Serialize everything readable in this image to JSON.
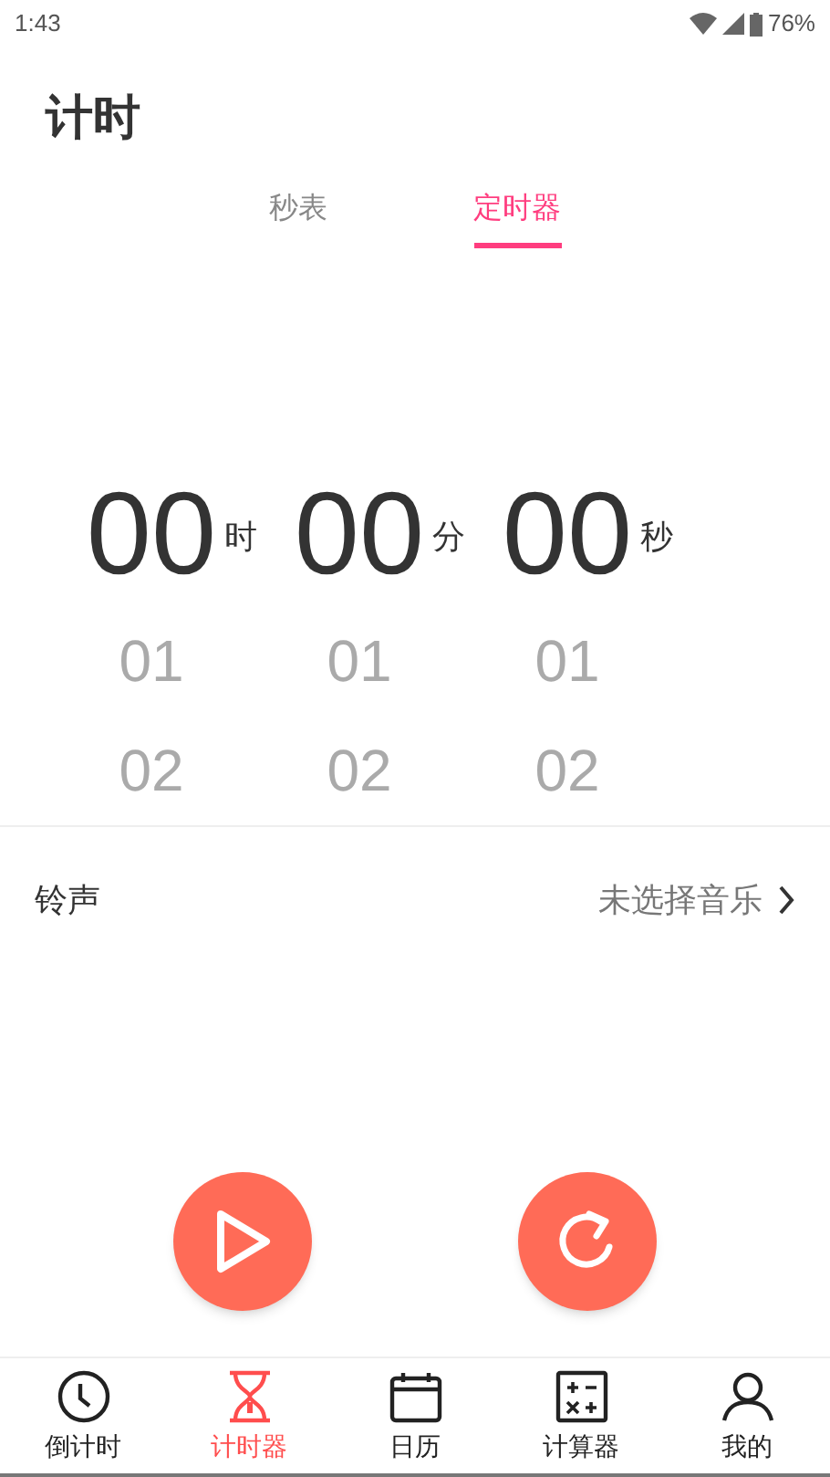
{
  "status_bar": {
    "time": "1:43",
    "battery": "76%"
  },
  "title": "计时",
  "tabs": [
    {
      "label": "秒表",
      "selected": false
    },
    {
      "label": "定时器",
      "selected": true
    }
  ],
  "picker": [
    {
      "unit": "时",
      "values": [
        {
          "text": "00",
          "selected": true
        },
        {
          "text": "01",
          "selected": false
        },
        {
          "text": "02",
          "selected": false
        }
      ]
    },
    {
      "unit": "分",
      "values": [
        {
          "text": "00",
          "selected": true
        },
        {
          "text": "01",
          "selected": false
        },
        {
          "text": "02",
          "selected": false
        }
      ]
    },
    {
      "unit": "秒",
      "values": [
        {
          "text": "00",
          "selected": true
        },
        {
          "text": "01",
          "selected": false
        },
        {
          "text": "02",
          "selected": false
        }
      ]
    }
  ],
  "ringtone": {
    "label": "铃声",
    "value": "未选择音乐"
  },
  "actions": [
    {
      "kind": "play"
    },
    {
      "kind": "reset"
    }
  ],
  "nav": [
    {
      "kind": "clock",
      "label": "倒计时",
      "selected": false
    },
    {
      "kind": "hourglass",
      "label": "计时器",
      "selected": true
    },
    {
      "kind": "calendar",
      "label": "日历",
      "selected": false
    },
    {
      "kind": "calculator",
      "label": "计算器",
      "selected": false
    },
    {
      "kind": "person",
      "label": "我的",
      "selected": false
    }
  ]
}
